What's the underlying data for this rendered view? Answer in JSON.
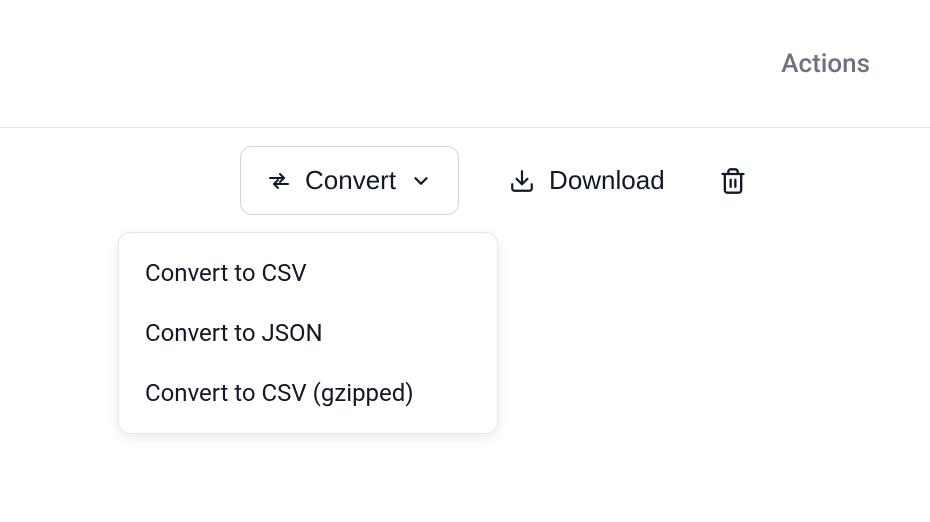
{
  "header": {
    "title": "Actions"
  },
  "toolbar": {
    "convert_label": "Convert",
    "download_label": "Download"
  },
  "dropdown": {
    "items": [
      {
        "label": "Convert to CSV"
      },
      {
        "label": "Convert to JSON"
      },
      {
        "label": "Convert to CSV (gzipped)"
      }
    ]
  }
}
